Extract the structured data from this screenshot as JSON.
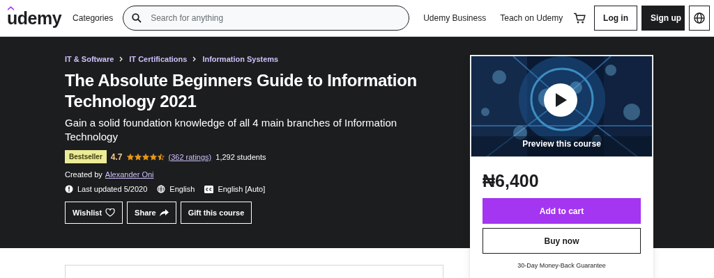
{
  "header": {
    "logo": "udemy",
    "categories": "Categories",
    "search": {
      "placeholder": "Search for anything"
    },
    "links": [
      "Udemy Business",
      "Teach on Udemy"
    ],
    "login": "Log in",
    "signup": "Sign up"
  },
  "breadcrumbs": [
    "IT & Software",
    "IT Certifications",
    "Information Systems"
  ],
  "title": "The Absolute Beginners Guide to Information Technology 2021",
  "subtitle": "Gain a solid foundation knowledge of all 4 main branches of Information Technology",
  "badge": "Bestseller",
  "rating": "4.7",
  "stars": 4.5,
  "ratings_link": "(362 ratings)",
  "students": "1,292 students",
  "created_by": "Created by",
  "author": "Alexander Oni",
  "meta": [
    {
      "kind": "updated",
      "text": "Last updated 5/2020"
    },
    {
      "kind": "language",
      "text": "English"
    },
    {
      "kind": "captions",
      "text": "English [Auto]"
    }
  ],
  "actions": [
    {
      "label": "Wishlist",
      "kind": "wishlist"
    },
    {
      "label": "Share",
      "kind": "share"
    },
    {
      "label": "Gift this course",
      "kind": "gift"
    }
  ],
  "card": {
    "preview": "Preview this course",
    "price": "₦6,400",
    "add_to_cart": "Add to cart",
    "buy_now": "Buy now",
    "guarantee": "30-Day Money-Back Guarantee"
  }
}
